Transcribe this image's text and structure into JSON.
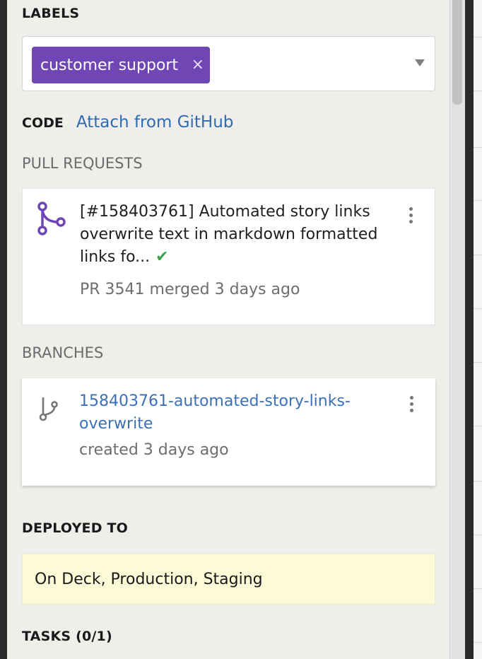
{
  "labels": {
    "heading": "LABELS",
    "chips": [
      {
        "text": "customer support",
        "remove": "×"
      }
    ]
  },
  "code": {
    "heading": "CODE",
    "attach_link": "Attach from GitHub"
  },
  "pull_requests": {
    "heading": "PULL REQUESTS",
    "items": [
      {
        "title": "[#158403761] Automated story links overwrite text in markdown formatted links fo...",
        "status_icon": "check-icon",
        "meta": "PR 3541 merged 3 days ago"
      }
    ]
  },
  "branches": {
    "heading": "BRANCHES",
    "items": [
      {
        "name": "158403761-automated-story-links-overwrite",
        "meta": "created 3 days ago"
      }
    ]
  },
  "deployed": {
    "heading": "DEPLOYED TO",
    "value": "On Deck, Production, Staging"
  },
  "tasks": {
    "heading": "TASKS (0/1)"
  },
  "colors": {
    "label_chip": "#7046b4",
    "link": "#2e6bb0",
    "merged_icon": "#7046b4",
    "check": "#3aa34a",
    "deployed_bg": "#fdfbd7"
  }
}
